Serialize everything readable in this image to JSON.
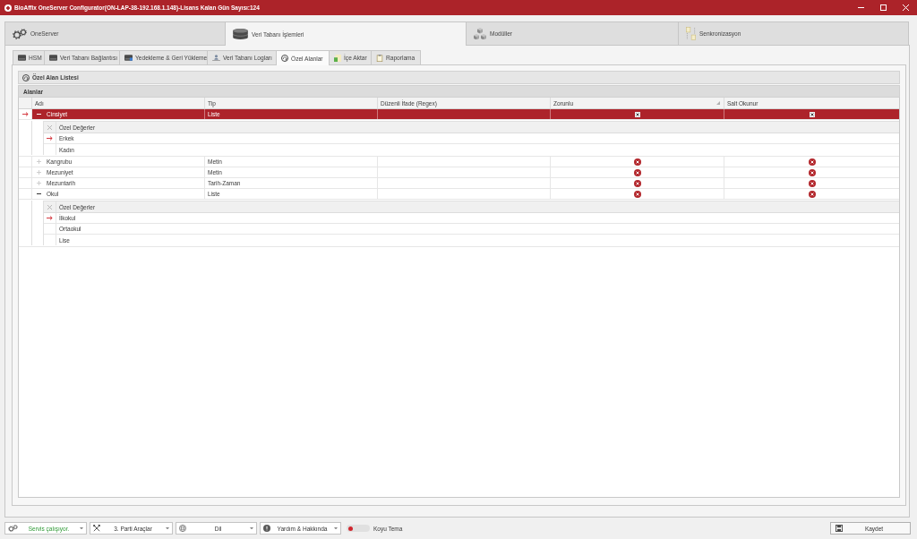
{
  "window": {
    "title": "BioAffix OneServer Configurator(ON-LAP-38-192.168.1.148)-Lisans Kalan Gün Sayısı:124"
  },
  "main_tabs": [
    {
      "label": "OneServer",
      "selected": false
    },
    {
      "label": "Veri Tabanı İşlemleri",
      "selected": true
    },
    {
      "label": "Modüller",
      "selected": false
    },
    {
      "label": "Senkronizasyon",
      "selected": false
    }
  ],
  "sub_tabs": [
    {
      "label": "HSM",
      "selected": false
    },
    {
      "label": "Veri Tabanı Bağlantısı",
      "selected": false
    },
    {
      "label": "Yedekleme & Geri Yükleme",
      "selected": false
    },
    {
      "label": "Veri Tabanı Logları",
      "selected": false
    },
    {
      "label": "Özel Alanlar",
      "selected": true
    },
    {
      "label": "İçe Aktar",
      "selected": false
    },
    {
      "label": "Raporlama",
      "selected": false
    }
  ],
  "group": {
    "title": "Özel Alan Listesi",
    "caption": "Alanlar"
  },
  "grid": {
    "columns": [
      {
        "label": "Adı",
        "filtered": false
      },
      {
        "label": "Tip",
        "filtered": false
      },
      {
        "label": "Düzenli İfade (Regex)",
        "filtered": false
      },
      {
        "label": "Zorunlu",
        "filtered": true
      },
      {
        "label": "Salt Okunur",
        "filtered": false
      }
    ],
    "rows": [
      {
        "name": "Cinsiyet",
        "type": "Liste",
        "required": false,
        "read_only": false,
        "selected": true,
        "expanded": true,
        "detail": {
          "column": "Özel Değerler",
          "values": [
            {
              "label": "Erkek",
              "selected": true
            },
            {
              "label": "Kadın",
              "selected": false
            }
          ]
        }
      },
      {
        "name": "Kangrubu",
        "type": "Metin",
        "required": false,
        "read_only": false,
        "selected": false,
        "expanded": false
      },
      {
        "name": "Mezuniyet",
        "type": "Metin",
        "required": false,
        "read_only": false,
        "selected": false,
        "expanded": false
      },
      {
        "name": "Mezuntarih",
        "type": "Tarih-Zaman",
        "required": false,
        "read_only": false,
        "selected": false,
        "expanded": false
      },
      {
        "name": "Okul",
        "type": "Liste",
        "required": false,
        "read_only": false,
        "selected": false,
        "expanded": true,
        "detail": {
          "column": "Özel Değerler",
          "values": [
            {
              "label": "İlkokul",
              "selected": true
            },
            {
              "label": "Ortaokul",
              "selected": false
            },
            {
              "label": "Lise",
              "selected": false
            }
          ]
        }
      }
    ]
  },
  "bottom_bar": {
    "dropdowns": [
      {
        "kind": "status",
        "label": "Servis çalışıyor."
      },
      {
        "kind": "menu",
        "label": "3. Parti Araçlar"
      },
      {
        "kind": "menu",
        "label": "Dil"
      },
      {
        "kind": "menu",
        "label": "Yardım & Hakkında"
      }
    ],
    "theme_toggle": {
      "label": "Koyu Tema",
      "on": false
    },
    "save_button": {
      "label": "Kaydet"
    }
  }
}
